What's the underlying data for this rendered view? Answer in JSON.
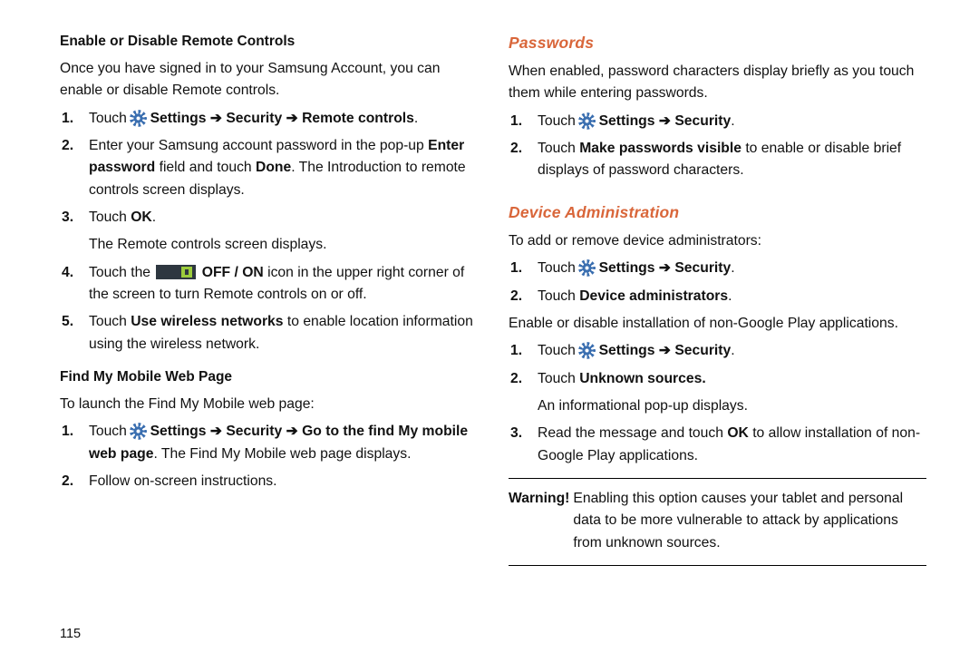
{
  "page_number": "115",
  "left": {
    "section1_title": "Enable or Disable Remote Controls",
    "section1_intro": "Once you have signed in to your Samsung Account, you can enable or disable Remote controls.",
    "s1_li1_a": "Touch ",
    "s1_li1_b": " Settings ➔ Security ➔ Remote controls",
    "s1_li1_c": ".",
    "s1_li2_a": "Enter your Samsung account password in the pop-up ",
    "s1_li2_b": "Enter password",
    "s1_li2_c": " field and touch ",
    "s1_li2_d": "Done",
    "s1_li2_e": ". The Introduction to remote controls screen displays.",
    "s1_li3_a": "Touch ",
    "s1_li3_b": "OK",
    "s1_li3_c": ".",
    "s1_li3_follow": "The Remote controls screen displays.",
    "s1_li4_a": "Touch the ",
    "s1_li4_b": " OFF / ON",
    "s1_li4_c": " icon in the upper right corner of the screen to turn Remote controls on or off.",
    "s1_li5_a": "Touch ",
    "s1_li5_b": "Use wireless networks",
    "s1_li5_c": " to enable location information using the wireless network.",
    "section2_title": "Find My Mobile Web Page",
    "section2_intro": "To launch the Find My Mobile web page:",
    "s2_li1_a": "Touch ",
    "s2_li1_b": " Settings ➔ Security ➔ Go to the find My mobile web page",
    "s2_li1_c": ". The Find My Mobile web page displays.",
    "s2_li2": "Follow on-screen instructions."
  },
  "right": {
    "passwords_title": "Passwords",
    "passwords_intro": "When enabled, password characters display briefly as you touch them while entering passwords.",
    "pw_li1_a": "Touch ",
    "pw_li1_b": " Settings ➔ Security",
    "pw_li1_c": ".",
    "pw_li2_a": "Touch ",
    "pw_li2_b": "Make passwords visible",
    "pw_li2_c": " to enable or disable brief displays of password characters.",
    "devadmin_title": "Device Administration",
    "devadmin_intro1": "To add or remove device administrators:",
    "da_li1_a": "Touch ",
    "da_li1_b": " Settings ➔ Security",
    "da_li1_c": ".",
    "da_li2_a": "Touch ",
    "da_li2_b": "Device administrators",
    "da_li2_c": ".",
    "devadmin_intro2": "Enable or disable installation of non-Google Play applications.",
    "da2_li1_a": "Touch ",
    "da2_li1_b": " Settings ➔ Security",
    "da2_li1_c": ".",
    "da2_li2_a": "Touch ",
    "da2_li2_b": "Unknown sources.",
    "da2_li2_follow": "An informational pop-up displays.",
    "da2_li3_a": "Read the message and touch ",
    "da2_li3_b": "OK",
    "da2_li3_c": " to allow installation of non-Google Play applications.",
    "warning_label": "Warning!",
    "warning_text": "Enabling this option causes your tablet and personal data to be more vulnerable to attack by applications from unknown sources."
  },
  "nums": {
    "n1": "1.",
    "n2": "2.",
    "n3": "3.",
    "n4": "4.",
    "n5": "5."
  }
}
